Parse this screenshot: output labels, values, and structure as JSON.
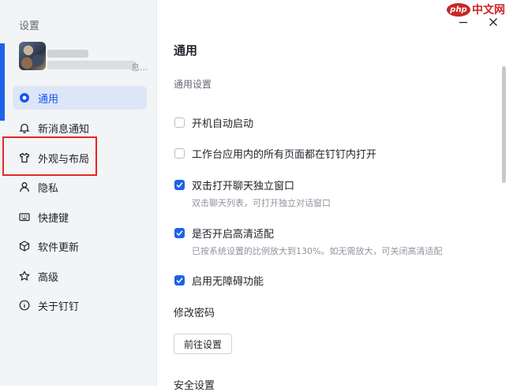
{
  "window": {
    "title": "设置"
  },
  "profile": {
    "name_suffix": "息..."
  },
  "sidebar": {
    "items": [
      {
        "label": "通用",
        "icon": "general-icon",
        "active": true
      },
      {
        "label": "新消息通知",
        "icon": "bell-icon"
      },
      {
        "label": "外观与布局",
        "icon": "shirt-icon"
      },
      {
        "label": "隐私",
        "icon": "person-icon"
      },
      {
        "label": "快捷键",
        "icon": "keyboard-icon"
      },
      {
        "label": "软件更新",
        "icon": "cube-icon"
      },
      {
        "label": "高级",
        "icon": "star-icon"
      },
      {
        "label": "关于钉钉",
        "icon": "info-icon"
      }
    ]
  },
  "main": {
    "section_title": "通用",
    "general_settings_label": "通用设置",
    "options": [
      {
        "label": "开机自动启动",
        "checked": false
      },
      {
        "label": "工作台应用内的所有页面都在钉钉内打开",
        "checked": false
      },
      {
        "label": "双击打开聊天独立窗口",
        "checked": true,
        "hint": "双击聊天列表，可打开独立对话窗口"
      },
      {
        "label": "是否开启高清适配",
        "checked": true,
        "hint": "已按系统设置的比例放大到130%。如无需放大，可关闭高清适配"
      },
      {
        "label": "启用无障碍功能",
        "checked": true
      }
    ],
    "password_label": "修改密码",
    "goto_button": "前往设置",
    "security_label": "安全设置"
  },
  "watermark": {
    "badge": "php",
    "text": "中文网"
  },
  "colors": {
    "accent": "#1e62e8",
    "highlight_border": "#e32828",
    "active_bg": "#dde6f9"
  }
}
